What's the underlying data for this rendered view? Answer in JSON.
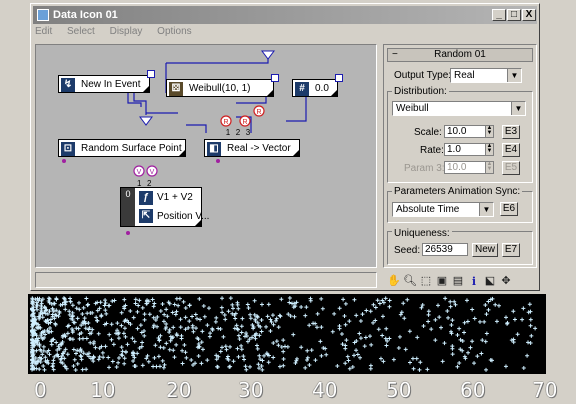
{
  "window": {
    "title": "Data Icon 01",
    "buttons": {
      "minimize": "_",
      "maximize": "□",
      "close": "X"
    }
  },
  "menu": [
    "Edit",
    "Select",
    "Display",
    "Options"
  ],
  "nodes": {
    "new_in_event": "New In Event",
    "weibull": "Weibull(10, 1)",
    "hash_value": "0.0",
    "random_surface_point": "Random Surface Point",
    "real_to_vector": "Real -> Vector",
    "v1_v2": "V1 + V2",
    "position_v": "Position V...",
    "counter": "0",
    "ports": {
      "r1": "R",
      "r2": "R",
      "r3": "R",
      "r4": "R",
      "c1": "1",
      "c2": "2",
      "c3": "3",
      "v1": "V",
      "v2": "V",
      "n1": "1",
      "n2": "2"
    }
  },
  "panel": {
    "header": "Random 01",
    "output_type_label": "Output Type:",
    "output_type_value": "Real",
    "distribution_label": "Distribution:",
    "distribution_value": "Weibull",
    "scale_label": "Scale:",
    "scale_value": "10.0",
    "scale_btn": "E3",
    "rate_label": "Rate:",
    "rate_value": "1.0",
    "rate_btn": "E4",
    "param3_label": "Param 3:",
    "param3_value": "10.0",
    "param3_btn": "E5",
    "anim_sync_label": "Parameters Animation Sync:",
    "anim_sync_value": "Absolute Time",
    "anim_sync_btn": "E6",
    "uniqueness_label": "Uniqueness:",
    "seed_label": "Seed:",
    "seed_value": "26539",
    "new_btn": "New",
    "seed_btn": "E7"
  },
  "toolbar_icons": [
    "hand-icon",
    "zoom-icon",
    "zoom-region-icon",
    "zoom-extents-icon",
    "zoom-all-icon",
    "info-icon",
    "select-icon",
    "pan-icon"
  ],
  "axis_labels": [
    "0",
    "10",
    "20",
    "30",
    "40",
    "50",
    "60",
    "70"
  ],
  "colors": {
    "particle": "#cfefff",
    "wire": "#1c1cb0",
    "port_red": "#d02020",
    "port_purple": "#a020a0"
  }
}
